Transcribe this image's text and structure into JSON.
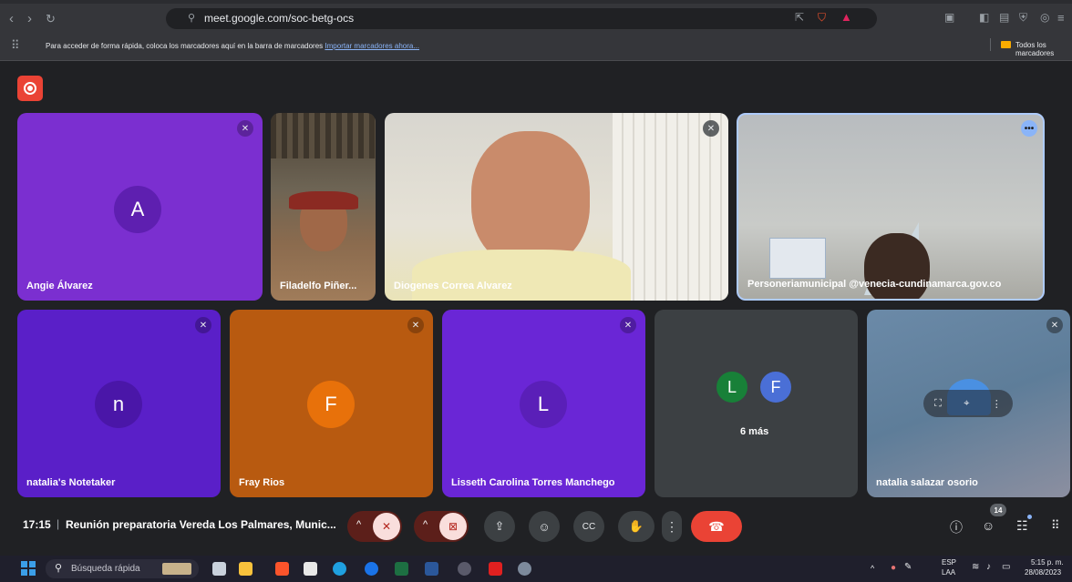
{
  "browser": {
    "url": "meet.google.com/soc-betg-ocs",
    "bookmarks_text": "Para acceder de forma rápida, coloca los marcadores aquí en la barra de marcadores",
    "bookmarks_link": "Importar marcadores ahora...",
    "bookmarks_folder": "Todos los marcadores"
  },
  "participants": [
    {
      "name": "Angie Álvarez",
      "initial": "A"
    },
    {
      "name": "Filadelfo Piñer..."
    },
    {
      "name": "Diogenes Correa Alvarez"
    },
    {
      "name": "Personeriamunicipal @venecia-cundinamarca.gov.co"
    },
    {
      "name": "natalia's Notetaker",
      "initial": "n"
    },
    {
      "name": "Fray Rios",
      "initial": "F"
    },
    {
      "name": "Lisseth Carolina Torres Manchego",
      "initial": "L"
    },
    {
      "name": "natalia salazar osorio"
    }
  ],
  "others": {
    "initial1": "L",
    "initial2": "F",
    "label": "6 más"
  },
  "meeting": {
    "time": "17:15",
    "separator": "|",
    "title": "Reunión preparatoria Vereda Los Palmares, Munic...",
    "people_count": "14"
  },
  "taskbar": {
    "search": "Búsqueda rápida",
    "lang": "ESP",
    "lang2": "LAA",
    "clock_time": "5:15 p. m.",
    "clock_date": "28/08/2023"
  },
  "colors": {
    "purple": "#7b2fd0",
    "orange": "#b85a10",
    "end_call": "#ea4335",
    "muted_red": "#f9dedc"
  }
}
